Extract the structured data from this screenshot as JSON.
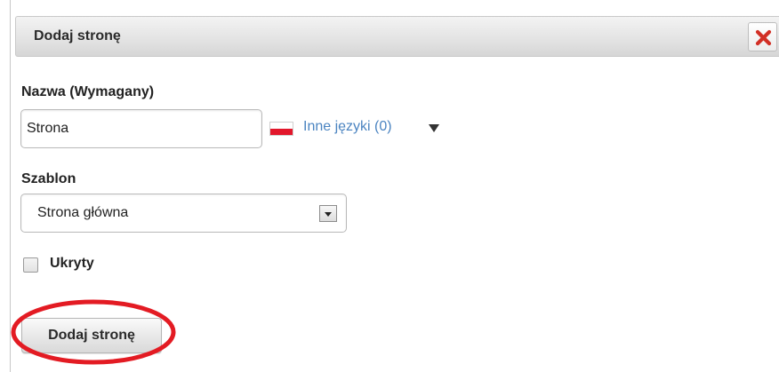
{
  "dialog": {
    "title": "Dodaj stronę"
  },
  "form": {
    "name_label": "Nazwa (Wymagany)",
    "name_value": "Strona",
    "other_languages_label": "Inne języki (0)",
    "template_label": "Szablon",
    "template_selected": "Strona główna",
    "hidden_label": "Ukryty",
    "hidden_checked": false,
    "submit_label": "Dodaj stronę"
  },
  "icons": {
    "close": "close-icon",
    "flag": "flag-pl-icon",
    "languages_dropdown": "triangle-down-icon",
    "select_arrow": "select-arrow-icon"
  },
  "colors": {
    "close_icon": "#d22f25",
    "link": "#4b84c1",
    "highlight": "#e31b23",
    "flag_red": "#e2172b"
  }
}
